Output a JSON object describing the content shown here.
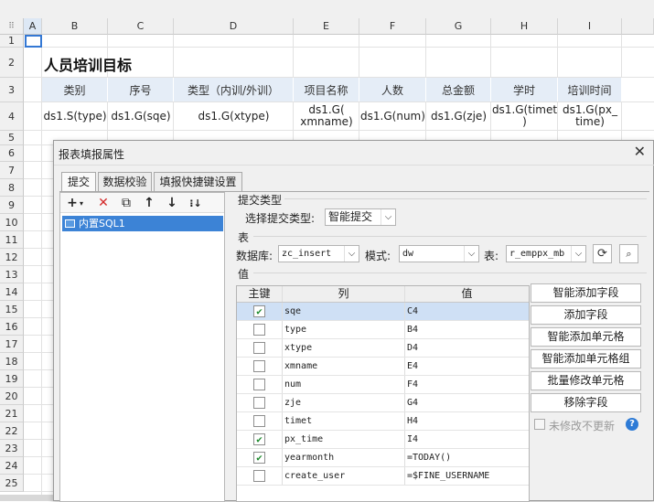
{
  "sheet": {
    "col_headers": [
      "A",
      "B",
      "C",
      "D",
      "E",
      "F",
      "G",
      "H",
      "I"
    ],
    "row_headers": [
      "1",
      "2",
      "3",
      "4",
      "5",
      "6",
      "7",
      "8",
      "9",
      "10",
      "11",
      "12",
      "13",
      "14",
      "15",
      "16",
      "17",
      "18",
      "19",
      "20",
      "21",
      "22",
      "23",
      "24",
      "25"
    ],
    "title": "人员培训目标",
    "header_row": [
      "类别",
      "序号",
      "类型（内训/外训）",
      "项目名称",
      "人数",
      "总金额",
      "学时",
      "培训时间"
    ],
    "data_row": [
      "ds1.S(type)",
      "ds1.G(sqe)",
      "ds1.G(xtype)",
      "ds1.G(\nxmname)",
      "ds1.G(num)",
      "ds1.G(zje)",
      "ds1.G(timet\n)",
      "ds1.G(px_\ntime)"
    ]
  },
  "dialog": {
    "title": "报表填报属性",
    "close": "✕",
    "tabs": [
      "提交",
      "数据校验",
      "填报快捷键设置"
    ],
    "tree_item": "内置SQL1",
    "submit_type_section": "提交类型",
    "submit_type_label": "选择提交类型:",
    "submit_type_value": "智能提交",
    "table_section": "表",
    "db_label": "数据库:",
    "db_value": "zc_insert",
    "schema_label": "模式:",
    "schema_value": "dw",
    "table_label": "表:",
    "table_value": "r_emppx_mb",
    "value_section": "值",
    "grid_headers": [
      "主键",
      "列",
      "值"
    ],
    "rows": [
      {
        "key": true,
        "col": "sqe",
        "val": "C4"
      },
      {
        "key": false,
        "col": "type",
        "val": "B4"
      },
      {
        "key": false,
        "col": "xtype",
        "val": "D4"
      },
      {
        "key": false,
        "col": "xmname",
        "val": "E4"
      },
      {
        "key": false,
        "col": "num",
        "val": "F4"
      },
      {
        "key": false,
        "col": "zje",
        "val": "G4"
      },
      {
        "key": false,
        "col": "timet",
        "val": "H4"
      },
      {
        "key": true,
        "col": "px_time",
        "val": "I4"
      },
      {
        "key": true,
        "col": "yearmonth",
        "val": "=TODAY()"
      },
      {
        "key": false,
        "col": "create_user",
        "val": "=$FINE_USERNAME"
      }
    ],
    "actions": [
      "智能添加字段",
      "添加字段",
      "智能添加单元格",
      "智能添加单元格组",
      "批量修改单元格",
      "移除字段"
    ],
    "no_update_label": "未修改不更新",
    "help": "?"
  }
}
